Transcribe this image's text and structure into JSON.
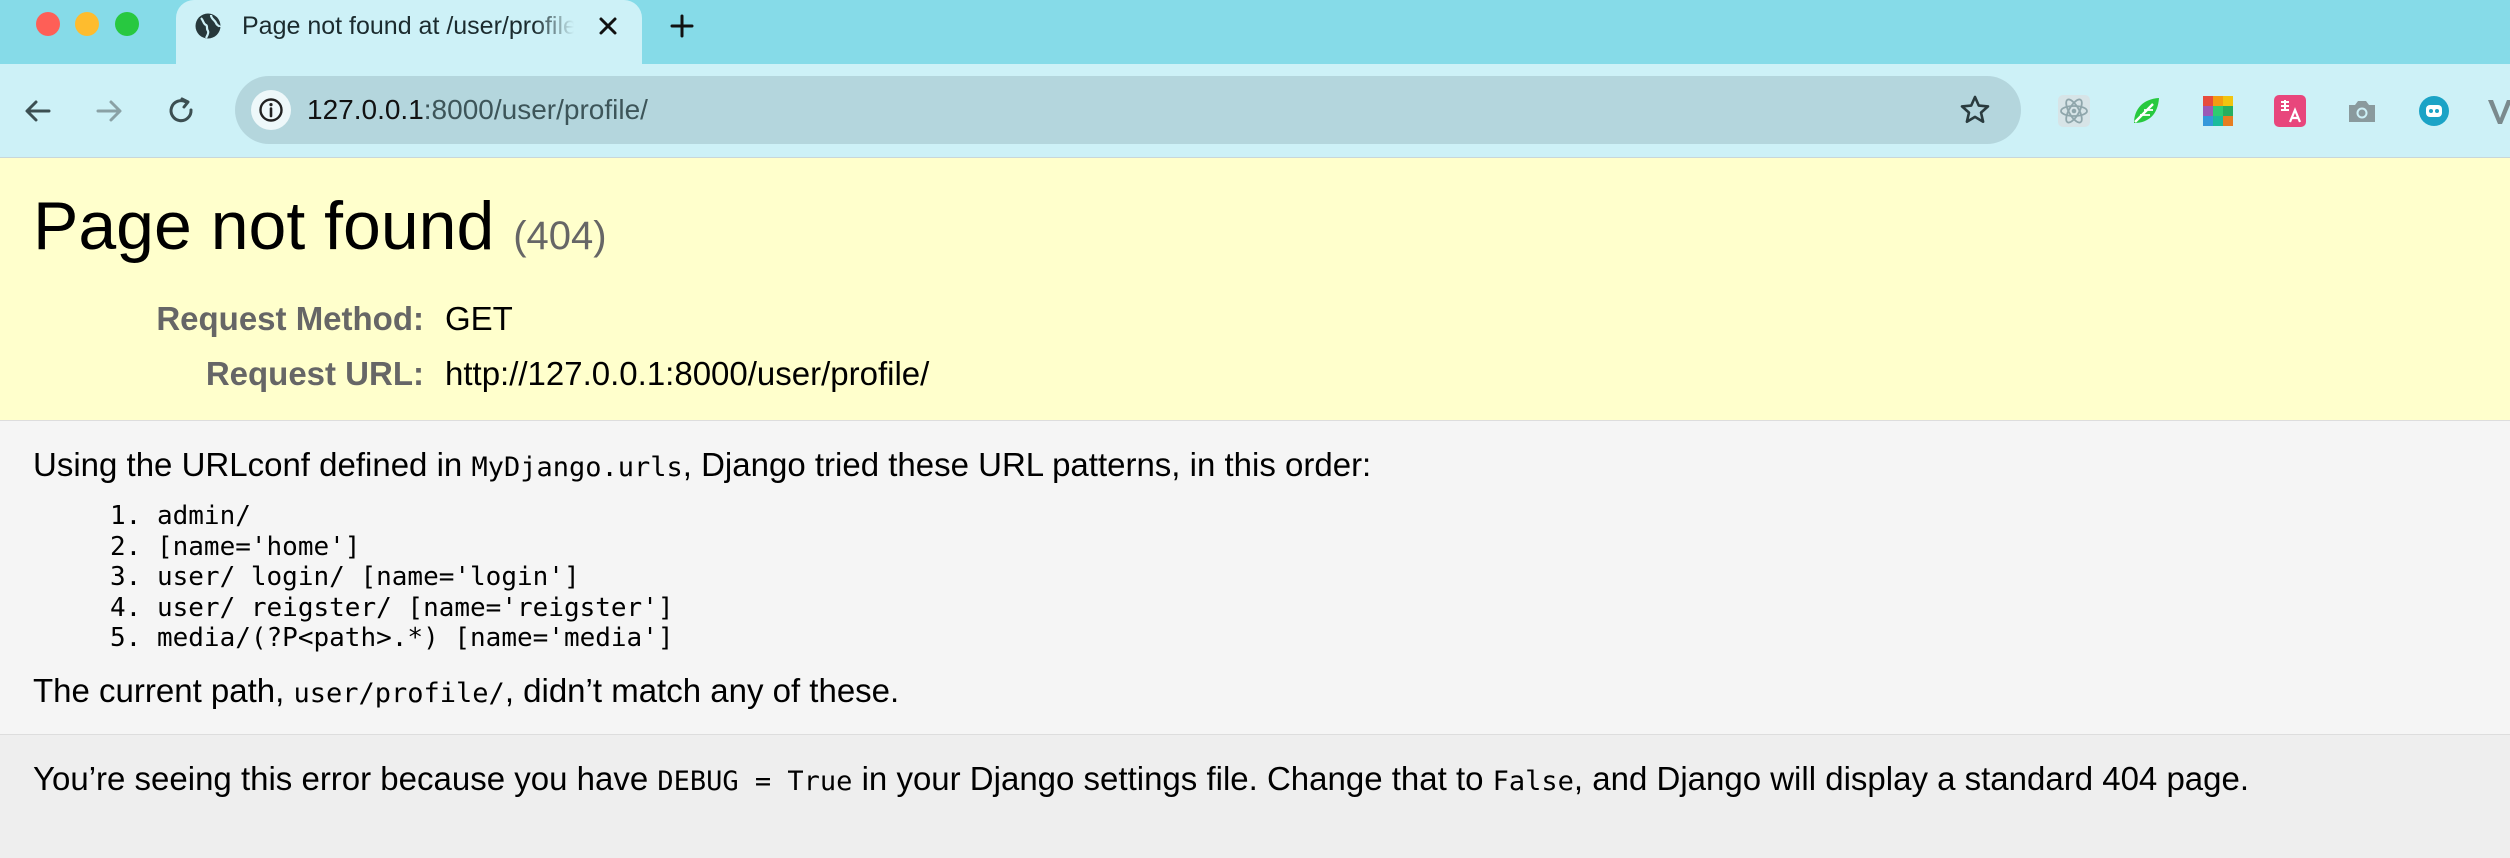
{
  "browser": {
    "tab_title": "Page not found at /user/profile/",
    "url_host": "127.0.0.1",
    "url_rest": ":8000/user/profile/",
    "extensions": [
      "react-devtools-icon",
      "leaf-extension-icon",
      "color-picker-icon",
      "translate-icon",
      "camera-icon",
      "robot-icon",
      "v-extension-icon"
    ],
    "colors": {
      "tabbar": "#86dbe8",
      "toolbar": "#cdf1f7",
      "omnibox": "#b4d6dd"
    }
  },
  "page": {
    "title": "Page not found",
    "status_code": "(404)",
    "request_method_label": "Request Method:",
    "request_method": "GET",
    "request_url_label": "Request URL:",
    "request_url": "http://127.0.0.1:8000/user/profile/",
    "urlconf_intro_before": "Using the URLconf defined in ",
    "urlconf_module": "MyDjango.urls",
    "urlconf_intro_after": ", Django tried these URL patterns, in this order:",
    "patterns": [
      "1. admin/",
      "2. [name='home']",
      "3. user/ login/ [name='login']",
      "4. user/ reigster/ [name='reigster']",
      "5. media/(?P<path>.*) [name='media']"
    ],
    "current_path_before": "The current path, ",
    "current_path": "user/profile/",
    "current_path_after": ", didn’t match any of these.",
    "debug_before": "You’re seeing this error because you have ",
    "debug_setting": "DEBUG = True",
    "debug_middle": " in your Django settings file. Change that to ",
    "debug_false": "False",
    "debug_after": ", and Django will display a standard 404 page.",
    "colors": {
      "summary_bg": "#ffffcc",
      "info_bg": "#f5f5f5",
      "explanation_bg": "#eeeeee",
      "label": "#666666"
    }
  }
}
